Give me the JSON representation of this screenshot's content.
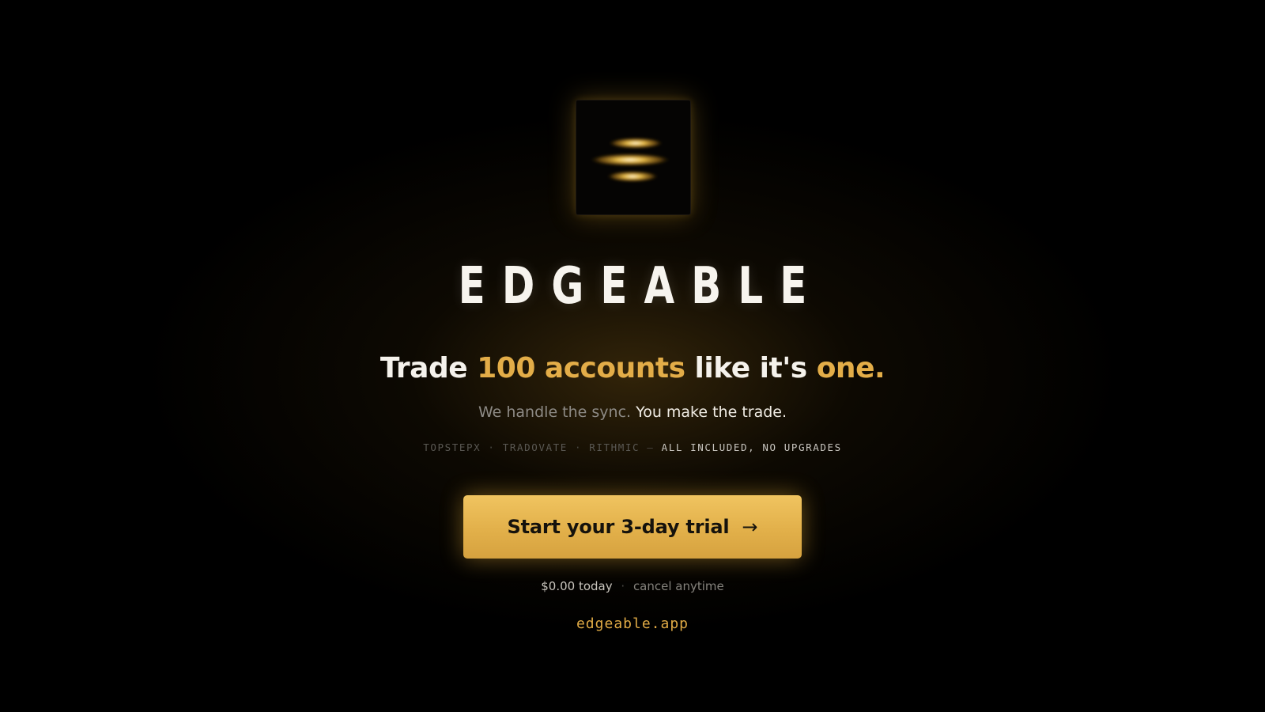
{
  "brand": {
    "logo_icon": "three-gold-bars-icon",
    "name": "EDGEABLE"
  },
  "headline": {
    "part1": "Trade",
    "highlight1": "100 accounts",
    "part2": "like it's",
    "highlight2": "one."
  },
  "subline": {
    "muted": "We handle the sync.",
    "bright": "You make the trade."
  },
  "platforms": {
    "items": [
      "TOPSTEPX",
      "TRADOVATE",
      "RITHMIC"
    ],
    "separator": "·",
    "dash": "—",
    "note": "ALL INCLUDED, NO UPGRADES"
  },
  "cta": {
    "label": "Start your 3-day trial",
    "arrow": "→"
  },
  "pricing": {
    "price": "$0.00 today",
    "dot": "·",
    "cancel": "cancel anytime"
  },
  "footer": {
    "domain": "edgeable.app"
  },
  "colors": {
    "background": "#000000",
    "accent_gold": "#e3ad48",
    "button_gold": "#e6b44e",
    "text_primary": "#f5f2ec"
  }
}
